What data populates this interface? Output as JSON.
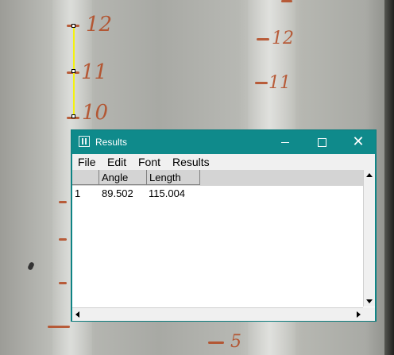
{
  "window": {
    "title": "Results",
    "icon": "imagej-icon",
    "controls": {
      "minimize": "minimize-icon",
      "maximize": "maximize-icon",
      "close": "close-icon"
    },
    "accent_color": "#0f8a8b"
  },
  "menu": [
    "File",
    "Edit",
    "Font",
    "Results"
  ],
  "table": {
    "columns": [
      "",
      "Angle",
      "Length"
    ],
    "rows": [
      {
        "index": "1",
        "angle": "89.502",
        "length": "115.004"
      }
    ]
  },
  "measurement": {
    "line_color": "#f4f20f"
  },
  "background": {
    "left_scale_numbers": [
      "12",
      "11",
      "10"
    ],
    "right_scale_numbers": [
      "12",
      "11",
      "5"
    ]
  }
}
